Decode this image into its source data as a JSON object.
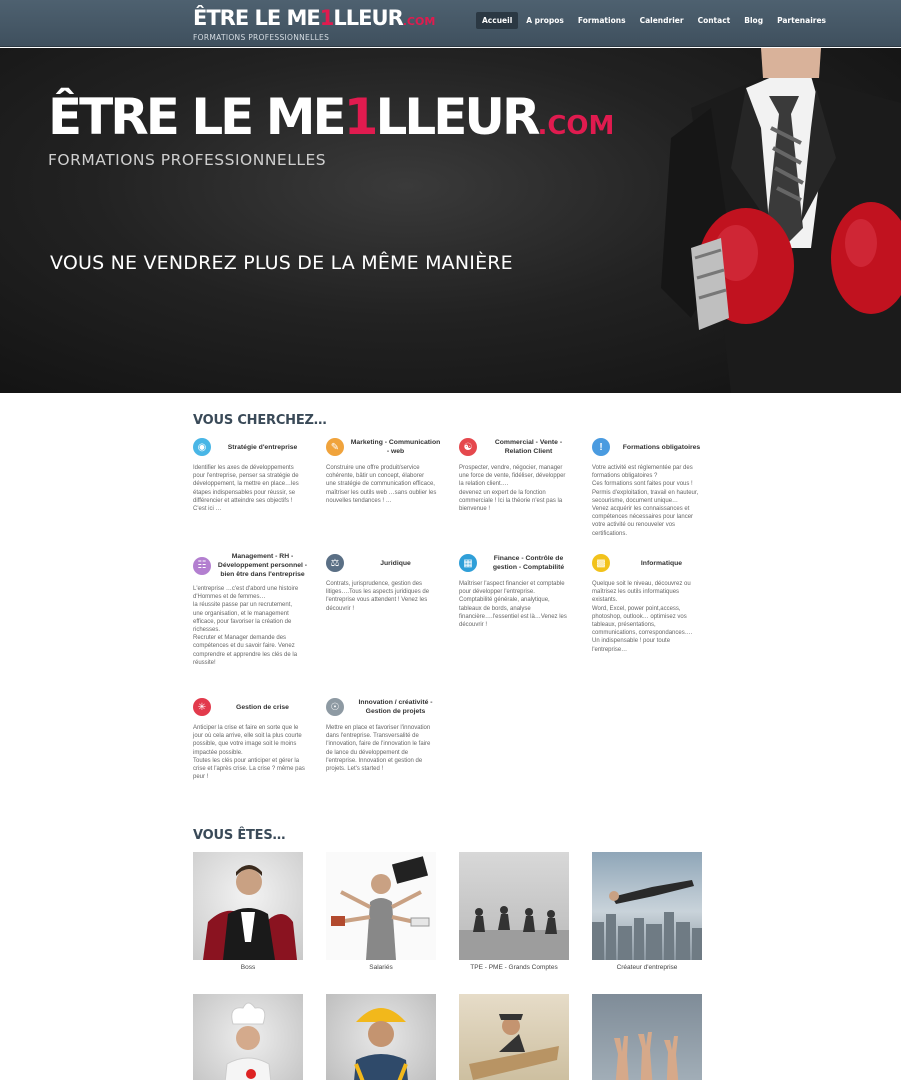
{
  "navbar": {
    "logo": {
      "part1": "ÊTRE LE ME",
      "one": "1",
      "part2": "LLEUR",
      "com": ".COM",
      "tagline": "FORMATIONS PROFESSIONNELLES"
    },
    "menu": [
      {
        "label": "Accueil",
        "active": true
      },
      {
        "label": "A propos"
      },
      {
        "label": "Formations"
      },
      {
        "label": "Calendrier"
      },
      {
        "label": "Contact"
      },
      {
        "label": "Blog"
      },
      {
        "label": "Partenaires"
      }
    ]
  },
  "hero": {
    "logo": {
      "part1": "ÊTRE LE ME",
      "one": "1",
      "part2": "LLEUR",
      "com": ".COM",
      "tagline": "FORMATIONS PROFESSIONNELLES"
    },
    "headline": "VOUS NE VENDREZ PLUS DE LA MÊME MANIÈRE"
  },
  "services": {
    "title": "VOUS CHERCHEZ…",
    "cards": [
      {
        "icon": "brain-icon",
        "color": "#49b6e6",
        "title": "Stratégie d'entreprise",
        "body": "Identifier les axes de développements\npour l'entreprise, penser sa stratégie de\ndéveloppement, la mettre en place…les\nétapes indispensables pour réussir, se\ndifférencier et atteindre ses objectifs !\nC'est ici …"
      },
      {
        "icon": "pencil-icon",
        "color": "#f0a33c",
        "title": "Marketing - Communication - web",
        "body": "Construire une offre produit/service\ncohérente, bâtir un concept, élaborer\nune stratégie de communication efficace,\nmaîtriser les outils web …sans oublier les\nnouvelles tendances ! …"
      },
      {
        "icon": "handshake-icon",
        "color": "#e5484d",
        "title": "Commercial - Vente - Relation Client",
        "body": "Prospecter, vendre, négocier, manager\nune force de vente, fidéliser, développer\nla relation client….\ndevenez un expert de la fonction\ncommerciale ! Ici la théorie n'est pas la\nbienvenue !"
      },
      {
        "icon": "info-icon",
        "color": "#4a9be0",
        "title": "Formations obligatoires",
        "body": "Votre activité est réglementée par des\nformations obligatoires ?\nCes formations sont faites pour vous !\nPermis d'exploitation, travail en hauteur,\nsecourisme, document unique…\nVenez acquérir les connaissances et\ncompétences nécessaires pour lancer\nvotre activité ou renouveler vos\ncertifications."
      },
      {
        "icon": "org-chart-icon",
        "color": "#b37fd0",
        "title": "Management - RH - Développement personnel - bien être dans l'entreprise",
        "body": "L'entreprise …c'est d'abord une histoire\nd'Hommes et de femmes…\nla réussite passe par un recrutement,\nune organisation,  et le management\nefficace, pour favoriser la création de\nrichesses.\nRecruter et Manager demande des\ncompétences et du savoir faire. Venez\ncomprendre et apprendre les clés de la\nréussite!"
      },
      {
        "icon": "scales-icon",
        "color": "#5a6f85",
        "title": "Juridique",
        "body": "Contrats, jurisprudence, gestion des\nlitiges….Tous les aspects juridiques de\nl'entreprise vous attendent ! Venez les\ndécouvrir !"
      },
      {
        "icon": "calculator-icon",
        "color": "#2f9fd8",
        "title": "Finance - Contrôle de gestion - Comptabilité",
        "body": "Maîtriser l'aspect financier et comptable\npour développer l'entreprise.\nComptabilité générale, analytique,\ntableaux de bords, analyse\nfinancière….l'essentiel est là…Venez les\ndécouvrir !"
      },
      {
        "icon": "laptop-icon",
        "color": "#f2c21b",
        "title": "Informatique",
        "body": "Quelque soit le  niveau, découvrez ou\nmaîtrisez les outils informatiques\nexistants.\nWord, Excel, power point,access,\nphotoshop, outlook… optimisez vos\ntableaux, présentations,\ncommunications, correspondances….\nUn indispensable ! pour toute\nl'entreprise…"
      },
      {
        "icon": "crisis-icon",
        "color": "#e23a4c",
        "title": "Gestion de crise",
        "body": "Anticiper la crise et faire en sorte que le\njour où cela arrive, elle soit la plus courte\npossible, que votre image soit le moins\nimpactée possible.\nToutes les clés pour anticiper et  gérer la\ncrise et l'après crise. La crise ? même pas\npeur !"
      },
      {
        "icon": "lightbulb-icon",
        "color": "#8e9aa3",
        "title": "Innovation / créativité - Gestion de projets",
        "body": "Mettre en place et favoriser l'innovation\ndans l'entreprise. Transversalité de\nl'innovation, faire de l'innovation le faire\nde lance du développement de\nl'entreprise. Innovation et gestion de\nprojets.  Let's started !"
      }
    ]
  },
  "audience": {
    "title": "VOUS ÊTES…",
    "tiles": [
      {
        "caption": "Boss"
      },
      {
        "caption": "Salariés"
      },
      {
        "caption": "TPE - PME - Grands Comptes"
      },
      {
        "caption": "Créateur d'entreprise"
      },
      {
        "caption": ""
      },
      {
        "caption": ""
      },
      {
        "caption": ""
      },
      {
        "caption": ""
      }
    ]
  }
}
